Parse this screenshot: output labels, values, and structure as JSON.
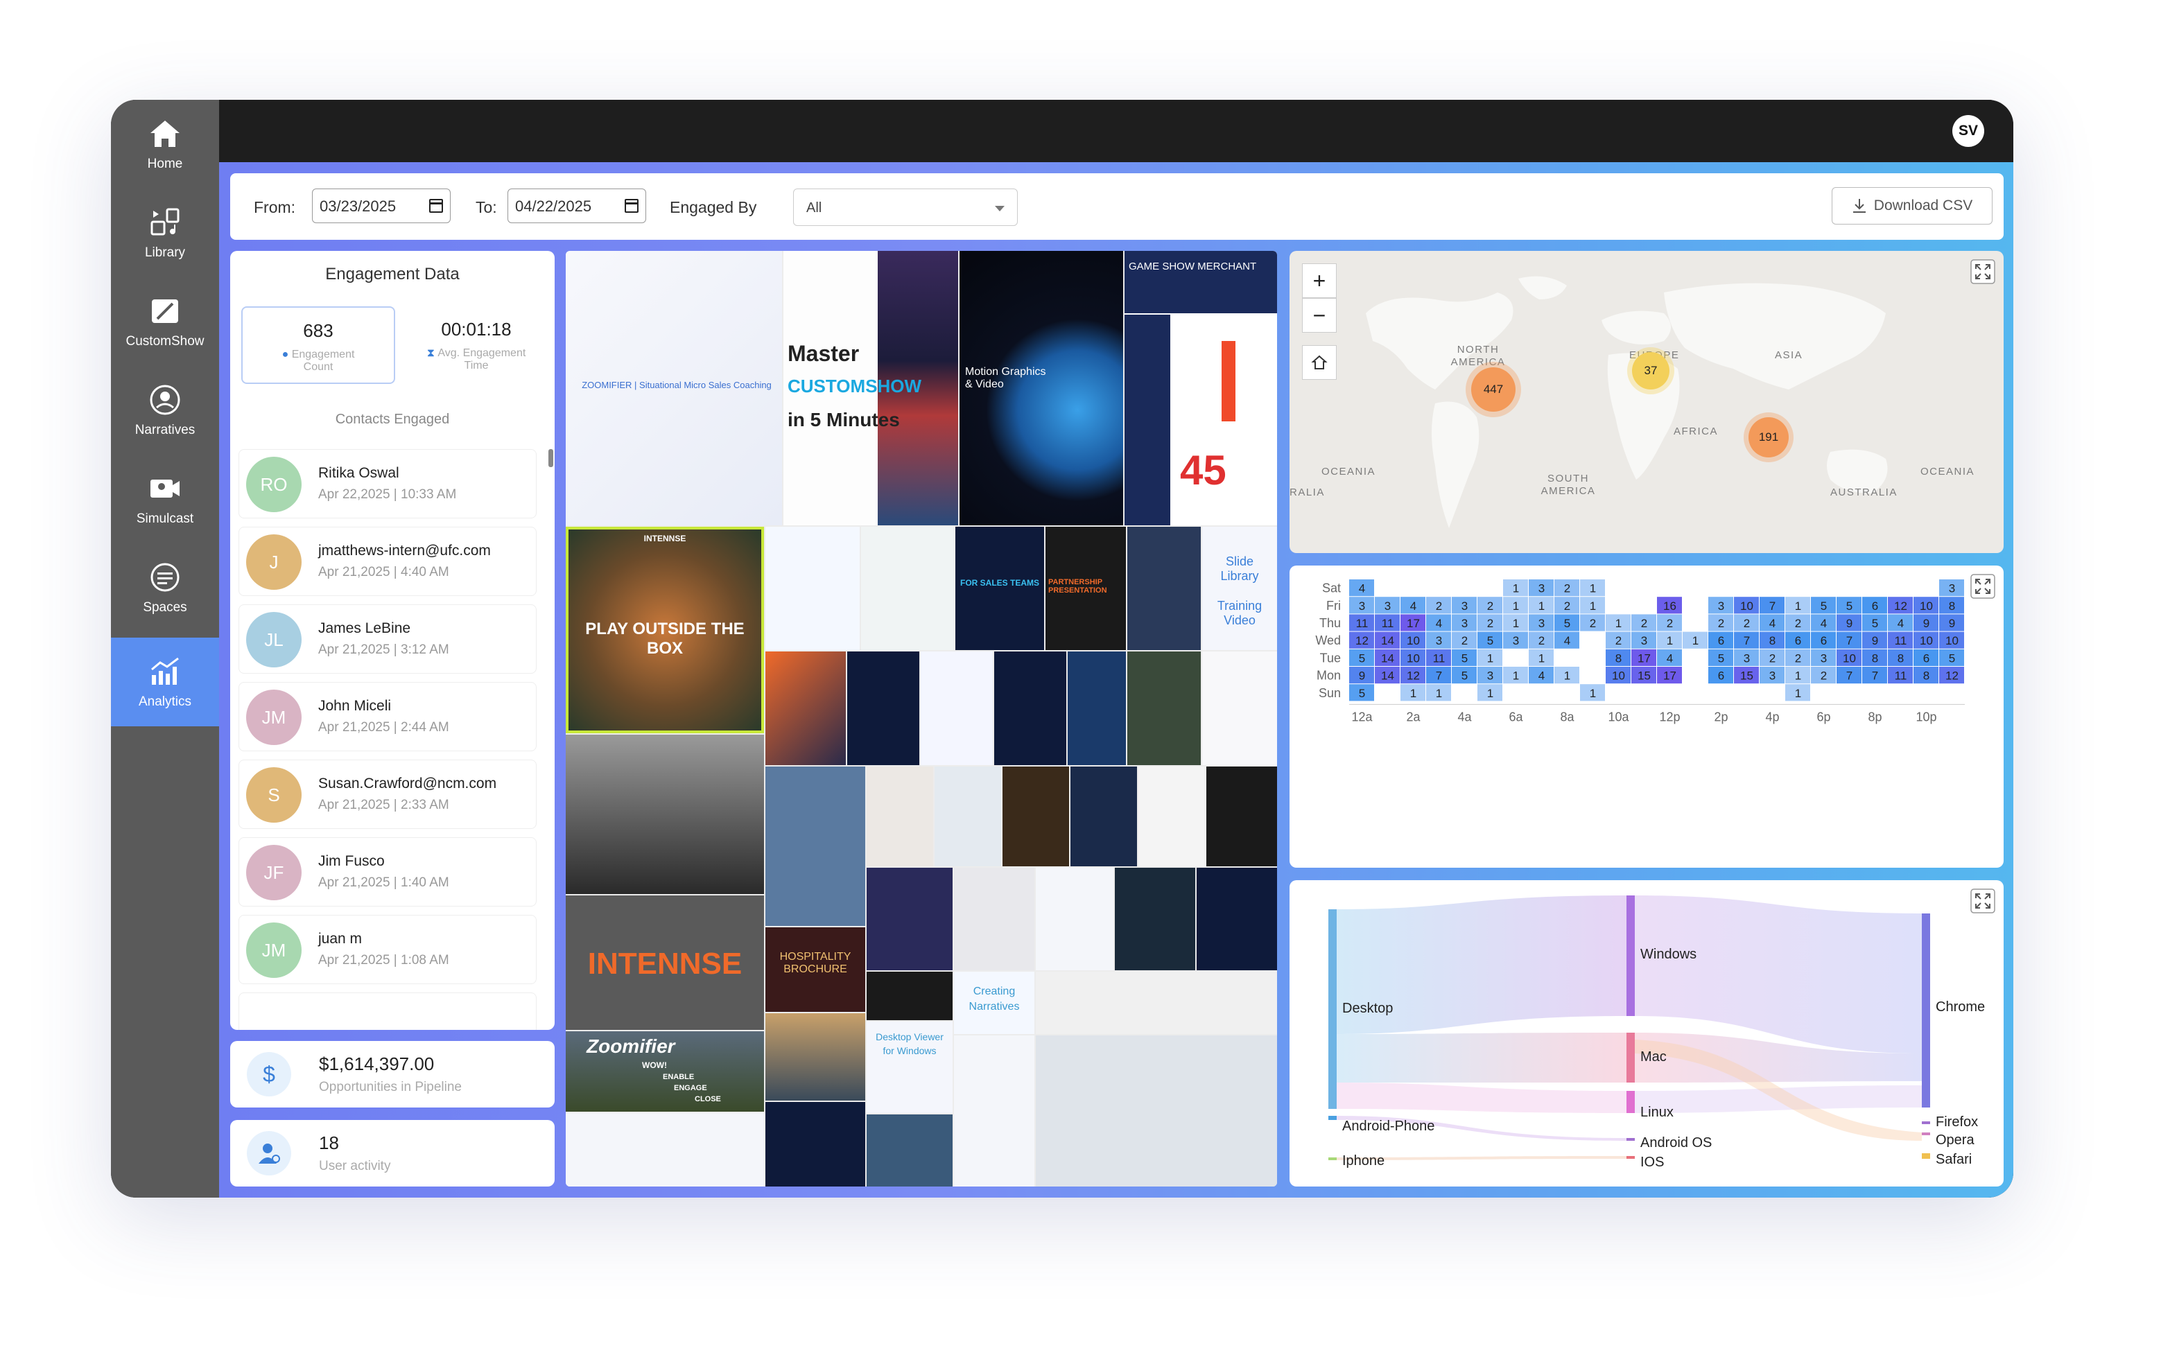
{
  "sidebar": {
    "items": [
      {
        "label": "Home",
        "icon": "home-icon"
      },
      {
        "label": "Library",
        "icon": "library-icon"
      },
      {
        "label": "CustomShow",
        "icon": "customshow-icon"
      },
      {
        "label": "Narratives",
        "icon": "narratives-icon"
      },
      {
        "label": "Simulcast",
        "icon": "simulcast-icon"
      },
      {
        "label": "Spaces",
        "icon": "spaces-icon"
      },
      {
        "label": "Analytics",
        "icon": "analytics-icon",
        "active": true
      }
    ]
  },
  "topbar": {
    "user_initials": "SV"
  },
  "filters": {
    "from_label": "From:",
    "from_value": "03/23/2025",
    "to_label": "To:",
    "to_value": "04/22/2025",
    "engaged_by_label": "Engaged By",
    "engaged_by_value": "All",
    "download_label": "Download CSV"
  },
  "engagement": {
    "title": "Engagement Data",
    "count_value": "683",
    "count_label_1": "Engagement",
    "count_label_2": "Count",
    "time_value": "00:01:18",
    "time_label_1": "Avg. Engagement",
    "time_label_2": "Time",
    "contacts_label": "Contacts Engaged",
    "contacts": [
      {
        "initials": "RO",
        "name": "Ritika Oswal",
        "date": "Apr 22,2025 | 10:33 AM",
        "color": "#a8d8b0"
      },
      {
        "initials": "J",
        "name": "jmatthews-intern@ufc.com",
        "date": "Apr 21,2025 | 4:40 AM",
        "color": "#e0b878"
      },
      {
        "initials": "JL",
        "name": "James LeBine",
        "date": "Apr 21,2025 | 3:12 AM",
        "color": "#a8cfe2"
      },
      {
        "initials": "JM",
        "name": "John Miceli",
        "date": "Apr 21,2025 | 2:44 AM",
        "color": "#d9b4c4"
      },
      {
        "initials": "S",
        "name": "Susan.Crawford@ncm.com",
        "date": "Apr 21,2025 | 2:33 AM",
        "color": "#e0b878"
      },
      {
        "initials": "JF",
        "name": "Jim Fusco",
        "date": "Apr 21,2025 | 1:40 AM",
        "color": "#d9b4c4"
      },
      {
        "initials": "JM",
        "name": "juan m",
        "date": "Apr 21,2025 | 1:08 AM",
        "color": "#a8d8b0"
      }
    ]
  },
  "pipeline": {
    "value": "$1,614,397.00",
    "label": "Opportunities in Pipeline",
    "icon": "dollar-icon"
  },
  "activity": {
    "value": "18",
    "label": "User activity",
    "icon": "user-activity-icon"
  },
  "mosaic": {
    "texts": {
      "zoomifier": "ZOOMIFIER | Situational Micro Sales Coaching",
      "master_1": "Master",
      "master_2": "CUSTOMSHOW",
      "master_3": "in 5 Minutes",
      "motion": "Motion Graphics & Video",
      "game_show": "GAME SHOW MERCHANT",
      "play_outside": "PLAY OUTSIDE THE BOX",
      "intennse_small": "INTENNSE",
      "intennse_big": "INTENNSE",
      "slide_library_1": "Slide Library",
      "slide_library_2": "Training Video",
      "partnership": "PARTNERSHIP PRESENTATION",
      "for_sales": "FOR SALES TEAMS",
      "hospitality": "HOSPITALITY BROCHURE",
      "creating_1": "Creating",
      "creating_2": "Narratives",
      "desktop_viewer_1": "Desktop Viewer",
      "desktop_viewer_2": "for Windows",
      "zoomifier_logo": "Zoomifier",
      "wow_1": "WOW!",
      "wow_2": "ENABLE",
      "wow_3": "ENGAGE",
      "wow_4": "CLOSE",
      "num_45": "45"
    }
  },
  "map": {
    "labels": {
      "north_america": "NORTH AMERICA",
      "europe": "EUROPE",
      "asia": "ASIA",
      "africa": "AFRICA",
      "south_america": "SOUTH AMERICA",
      "oceania_left": "OCEANIA",
      "oceania_right": "OCEANIA",
      "australia": "AUSTRALIA",
      "ralia": "RALIA"
    },
    "clusters": [
      {
        "value": "447",
        "color": "#f39a5a"
      },
      {
        "value": "37",
        "color": "#f3d05a"
      },
      {
        "value": "191",
        "color": "#f39a5a"
      }
    ],
    "zoom_in": "+",
    "zoom_out": "−"
  },
  "chart_data": {
    "type": "heatmap",
    "rows": [
      "Sat",
      "Fri",
      "Thu",
      "Wed",
      "Tue",
      "Mon",
      "Sun"
    ],
    "x_tick_labels": [
      "12a",
      "2a",
      "4a",
      "6a",
      "8a",
      "10a",
      "12p",
      "2p",
      "4p",
      "6p",
      "8p",
      "10p"
    ],
    "columns": 24,
    "values": [
      [
        4,
        null,
        null,
        null,
        null,
        null,
        1,
        3,
        2,
        1,
        null,
        null,
        null,
        null,
        null,
        null,
        null,
        null,
        null,
        null,
        null,
        null,
        null,
        3
      ],
      [
        3,
        3,
        4,
        2,
        3,
        2,
        1,
        1,
        2,
        1,
        null,
        null,
        16,
        null,
        3,
        10,
        7,
        1,
        5,
        5,
        6,
        12,
        10,
        8
      ],
      [
        11,
        11,
        17,
        4,
        3,
        2,
        1,
        3,
        5,
        2,
        1,
        2,
        2,
        null,
        2,
        2,
        4,
        2,
        4,
        9,
        5,
        4,
        9,
        9
      ],
      [
        12,
        14,
        10,
        3,
        2,
        5,
        3,
        2,
        4,
        null,
        2,
        3,
        1,
        1,
        6,
        7,
        8,
        6,
        6,
        7,
        9,
        11,
        10,
        10
      ],
      [
        5,
        14,
        10,
        11,
        5,
        1,
        null,
        1,
        null,
        null,
        8,
        17,
        4,
        null,
        5,
        3,
        2,
        2,
        3,
        10,
        8,
        8,
        6,
        5
      ],
      [
        9,
        14,
        12,
        7,
        5,
        3,
        1,
        4,
        1,
        null,
        10,
        15,
        17,
        null,
        6,
        15,
        3,
        1,
        2,
        7,
        7,
        11,
        8,
        12
      ],
      [
        5,
        null,
        1,
        1,
        null,
        1,
        null,
        null,
        null,
        1,
        null,
        null,
        null,
        null,
        null,
        null,
        null,
        1,
        null,
        null,
        null,
        null,
        null,
        null
      ]
    ]
  },
  "sankey": {
    "nodes": {
      "desktop": "Desktop",
      "android_phone": "Android-Phone",
      "iphone": "Iphone",
      "windows": "Windows",
      "mac": "Mac",
      "linux": "Linux",
      "android_os": "Android OS",
      "ios": "IOS",
      "chrome": "Chrome",
      "firefox": "Firefox",
      "opera": "Opera",
      "safari": "Safari"
    }
  }
}
